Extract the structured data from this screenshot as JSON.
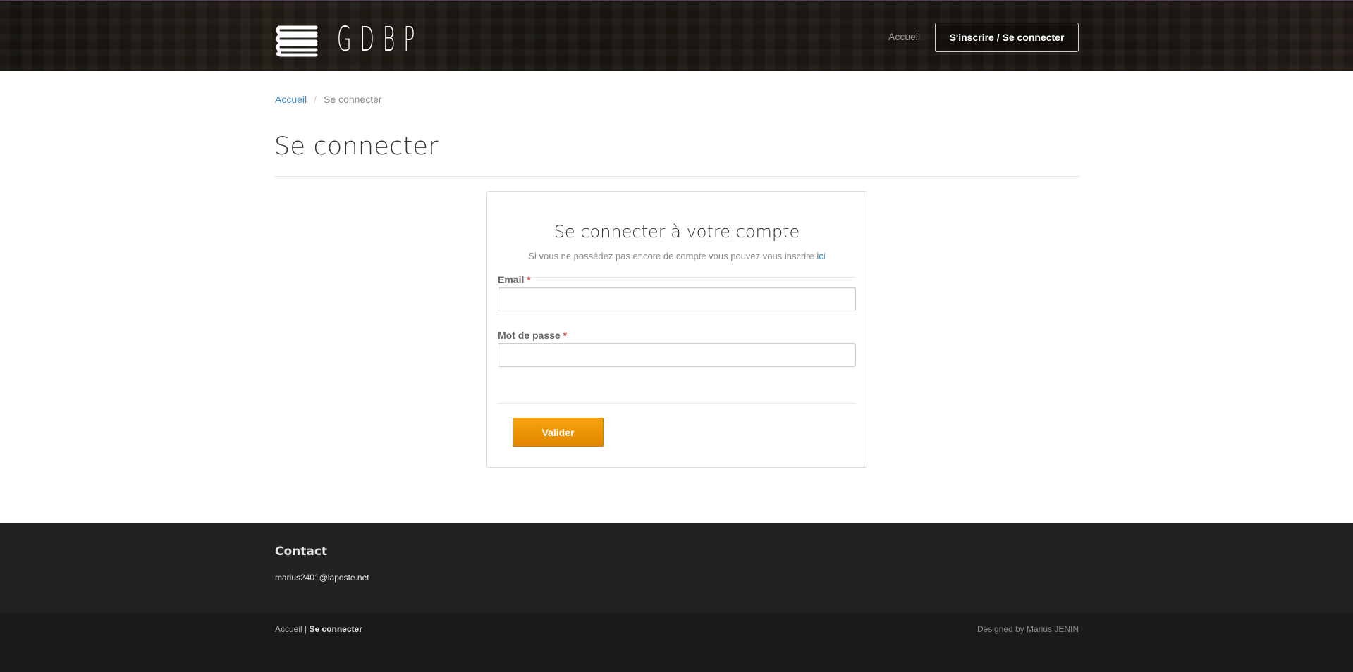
{
  "header": {
    "logo_text": "GDBP",
    "nav_home": "Accueil",
    "nav_auth": "S'inscrire / Se connecter"
  },
  "breadcrumb": {
    "home": "Accueil",
    "separator": "/",
    "current": "Se connecter"
  },
  "page": {
    "title": "Se connecter"
  },
  "login": {
    "title": "Se connecter à votre compte",
    "subtitle": "Si vous ne possédez pas encore de compte vous pouvez vous inscrire",
    "subtitle_link": "ici",
    "email_label": "Email",
    "email_value": "",
    "password_label": "Mot de passe",
    "password_value": "",
    "required_marker": "*",
    "submit_label": "Valider"
  },
  "footer": {
    "contact_title": "Contact",
    "contact_email": "marius2401@laposte.net",
    "nav_home": "Accueil",
    "nav_separator": "|",
    "nav_current": "Se connecter",
    "credit": "Designed by Marius JENIN"
  },
  "colors": {
    "accent_orange": "#f29500",
    "link_blue": "#3c88c8",
    "footer_dark": "#222222",
    "footer_darker": "#1a1a1a"
  },
  "icons": {
    "logo": "stacked-books-icon"
  }
}
